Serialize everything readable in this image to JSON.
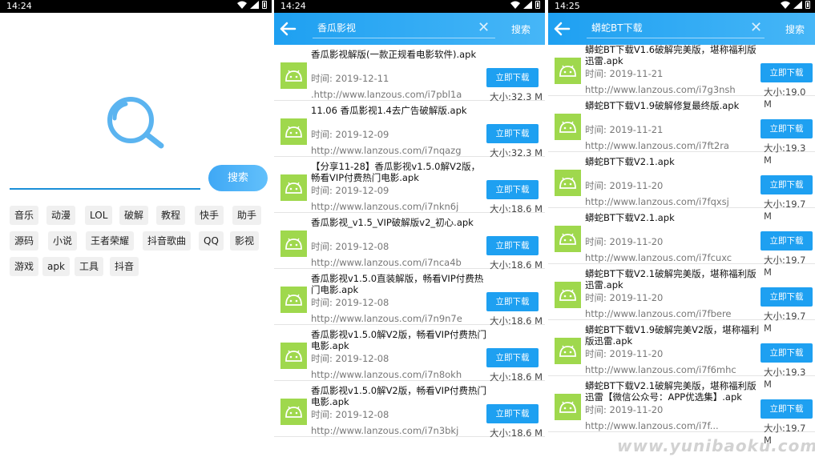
{
  "panel1": {
    "status_time": "14:24",
    "search_button": "搜索",
    "tags": [
      "音乐",
      "动漫",
      "LOL",
      "破解",
      "教程",
      "快手",
      "助手",
      "源码",
      "小说",
      "王者荣耀",
      "抖音歌曲",
      "QQ",
      "影视",
      "游戏",
      "apk",
      "工具",
      "抖音"
    ]
  },
  "panel2": {
    "status_time": "14:24",
    "query": "香瓜影视",
    "search_label": "搜索",
    "items": [
      {
        "title": "香瓜影视解版(一款正规看电影软件).apk",
        "time": "时间:  2019-12-11",
        "url": ".http://www.lanzous.com/i7pbl1a",
        "button": "立即下载",
        "size": "大小:32.3 M"
      },
      {
        "title": "11.06 香瓜影视1.4去广告破解版.apk",
        "time": "时间:  2019-12-09",
        "url": "http://www.lanzous.com/i7nqazg",
        "button": "立即下载",
        "size": "大小:32.3 M"
      },
      {
        "title": "【分享11-28】香瓜影视v1.5.0解V2版，畅看VIP付费热门电影.apk",
        "time": "时间:  2019-12-09",
        "url": "http://www.lanzous.com/i7nkn6j",
        "button": "立即下载",
        "size": "大小:18.6 M"
      },
      {
        "title": "香瓜影视_v1.5_VIP破解版v2_初心.apk",
        "time": "时间:  2019-12-08",
        "url": "http://www.lanzous.com/i7nca4b",
        "button": "立即下载",
        "size": "大小:18.6 M"
      },
      {
        "title": "香瓜影视v1.5.0直装解版，畅看VIP付费热门电影.apk",
        "time": "时间:  2019-12-08",
        "url": "http://www.lanzous.com/i7n9n7e",
        "button": "立即下载",
        "size": "大小:18.6 M"
      },
      {
        "title": "香瓜影视v1.5.0解V2版，畅看VIP付费热门电影.apk",
        "time": "时间:  2019-12-08",
        "url": "http://www.lanzous.com/i7n8okh",
        "button": "立即下载",
        "size": "大小:18.6 M"
      },
      {
        "title": "香瓜影视v1.5.0解V2版，畅看VIP付费热门电影.apk",
        "time": "时间:  2019-12-08",
        "url": "http://www.lanzous.com/i7n3bkj",
        "button": "立即下载",
        "size": "大小:18.6 M"
      }
    ]
  },
  "panel3": {
    "status_time": "14:25",
    "query": "蟒蛇BT下载",
    "search_label": "搜索",
    "items": [
      {
        "title": "蟒蛇BT下载V1.6破解完美版，堪称福利版迅雷.apk",
        "time": "时间:  2019-11-21",
        "url": "http://www.lanzous.com/i7g3nsh",
        "button": "立即下载",
        "size": "大小:19.0 M"
      },
      {
        "title": "蟒蛇BT下载V1.9破解修复最终版.apk",
        "time": "时间:  2019-11-21",
        "url": "http://www.lanzous.com/i7ft2ra",
        "button": "立即下载",
        "size": "大小:19.3 M"
      },
      {
        "title": "蟒蛇BT下载V2.1.apk",
        "time": "时间:  2019-11-20",
        "url": "http://www.lanzous.com/i7fqxsj",
        "button": "立即下载",
        "size": "大小:19.7 M"
      },
      {
        "title": "蟒蛇BT下载V2.1.apk",
        "time": "时间:  2019-11-20",
        "url": "http://www.lanzous.com/i7fcuxc",
        "button": "立即下载",
        "size": "大小:19.7 M"
      },
      {
        "title": "蟒蛇BT下载V2.1破解完美版，堪称福利版迅雷.apk",
        "time": "时间:  2019-11-20",
        "url": "http://www.lanzous.com/i7fbere",
        "button": "立即下载",
        "size": "大小:19.7 M"
      },
      {
        "title": "蟒蛇BT下载V1.9破解完美V2版，堪称福利版迅雷.apk",
        "time": "时间:  2019-11-20",
        "url": "http://www.lanzous.com/i7f6mhc",
        "button": "立即下载",
        "size": "大小:19.3 M"
      },
      {
        "title": "蟒蛇BT下载V2.1破解完美版，堪称福利版迅雷【微信公众号：APP优选集】.apk",
        "time": "时间:  2019-11-20",
        "url": "http://www.lanzous.com/i7f...",
        "button": "立即下载",
        "size": "大小:19.7 M"
      }
    ]
  },
  "watermark": "www.yunibaoku.com",
  "colors": {
    "accent": "#1ea0f1",
    "apk_icon": "#9fd84d"
  }
}
